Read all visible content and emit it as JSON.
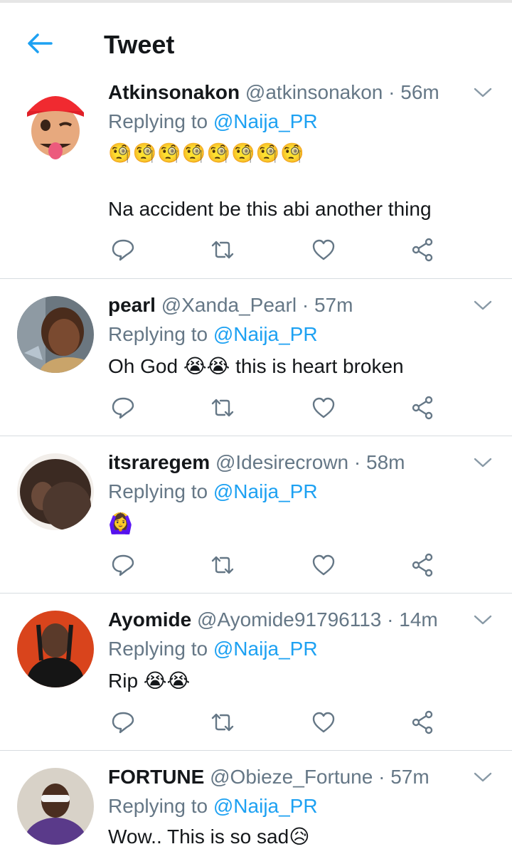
{
  "header": {
    "title": "Tweet",
    "back_icon": "arrow-left-icon",
    "accent": "#1da1f2"
  },
  "tweets": [
    {
      "name": "Atkinsonakon",
      "handle": "@atkinsonakon",
      "time": "56m",
      "replying_prefix": "Replying to",
      "replying_to": "@Naija_PR",
      "emoji_line": "🧐🧐🧐🧐🧐🧐🧐🧐",
      "text": "Na accident be this abi another thing"
    },
    {
      "name": "pearl",
      "handle": "@Xanda_Pearl",
      "time": "57m",
      "replying_prefix": "Replying to",
      "replying_to": "@Naija_PR",
      "text_before": "Oh God",
      "text_emoji": "😭😭",
      "text_after": "this is heart broken"
    },
    {
      "name": "itsraregem",
      "handle": "@Idesirecrown",
      "time": "58m",
      "replying_prefix": "Replying to",
      "replying_to": "@Naija_PR",
      "emoji_line": "🙆‍♀️"
    },
    {
      "name": "Ayomide",
      "handle": "@Ayomide91796113",
      "time": "14m",
      "replying_prefix": "Replying to",
      "replying_to": "@Naija_PR",
      "text_before": "Rip",
      "text_emoji": "😭😭"
    },
    {
      "name": "FORTUNE",
      "handle": "@Obieze_Fortune",
      "time": "57m",
      "replying_prefix": "Replying to",
      "replying_to": "@Naija_PR",
      "text_before": "Wow.. This is so sad",
      "text_emoji": "😥"
    }
  ],
  "actions": [
    "reply-icon",
    "retweet-icon",
    "like-icon",
    "share-icon"
  ],
  "separator": "·"
}
